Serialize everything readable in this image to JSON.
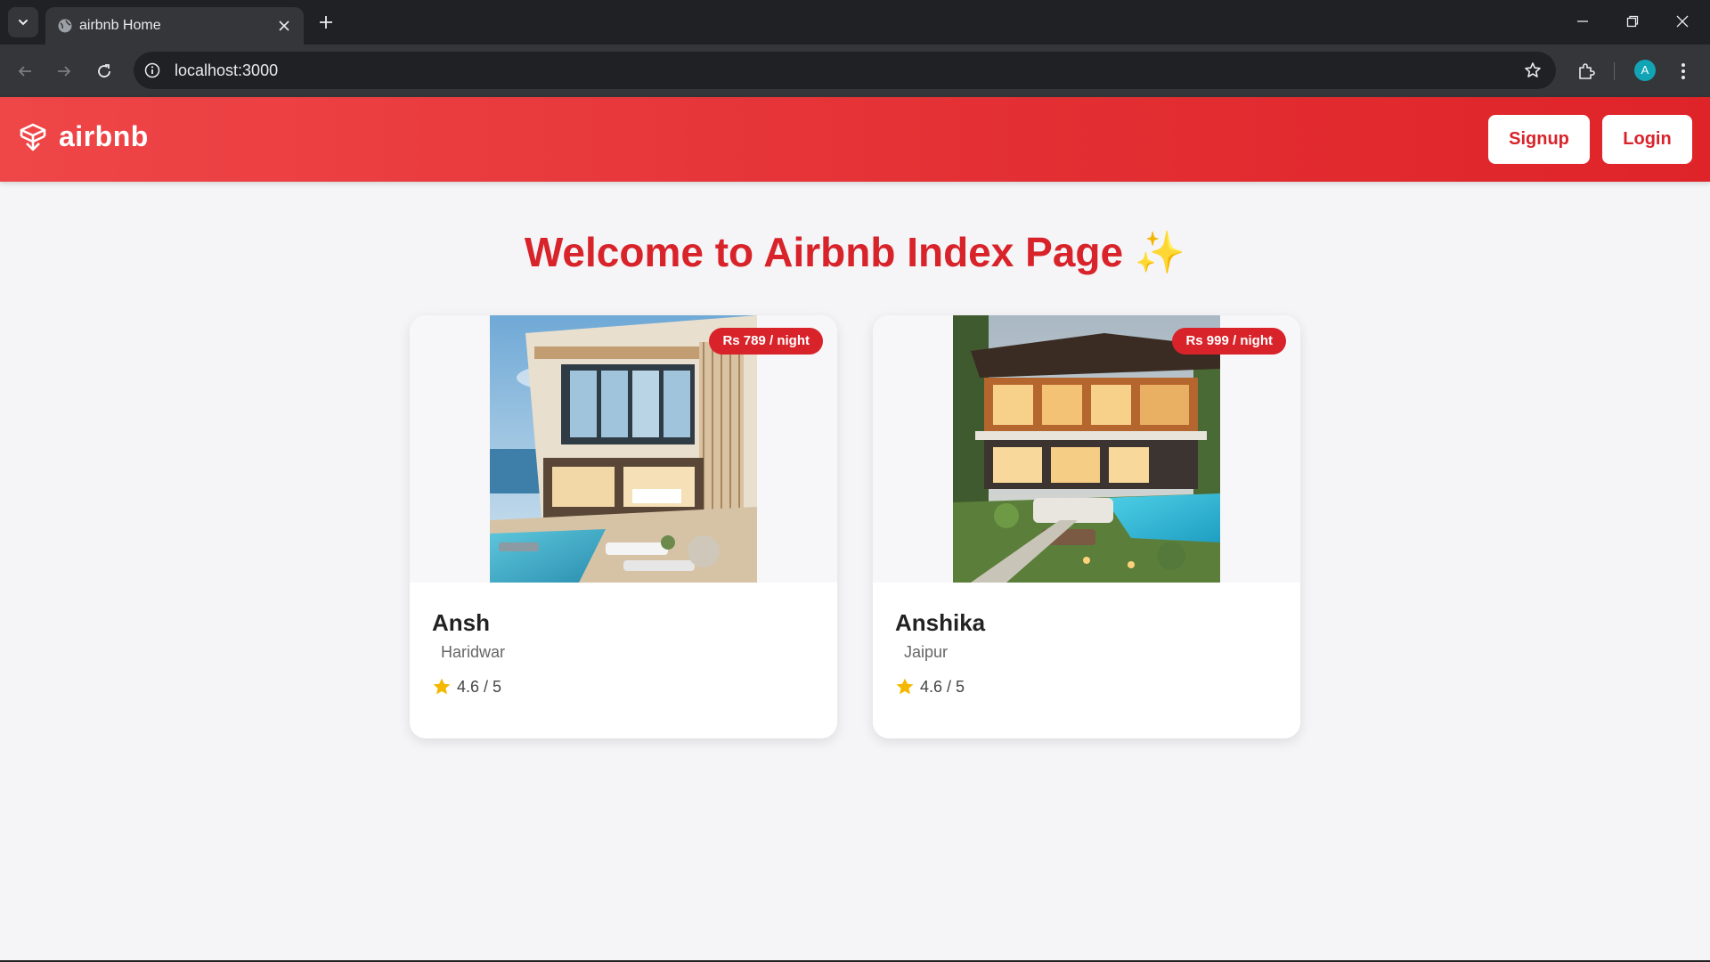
{
  "browser": {
    "tab_title": "airbnb Home",
    "url": "localhost:3000",
    "avatar_letter": "A"
  },
  "navbar": {
    "logo_text": "airbnb",
    "signup_label": "Signup",
    "login_label": "Login"
  },
  "page": {
    "heading": "Welcome to Airbnb Index Page ✨"
  },
  "listings": [
    {
      "title": "Ansh",
      "location": "Haridwar",
      "price": "Rs 789 / night",
      "rating": "4.6 / 5"
    },
    {
      "title": "Anshika",
      "location": "Jaipur",
      "price": "Rs 999 / night",
      "rating": "4.6 / 5"
    }
  ],
  "colors": {
    "brand": "#df2429",
    "heading": "#d8232a",
    "star": "#f5b800"
  }
}
